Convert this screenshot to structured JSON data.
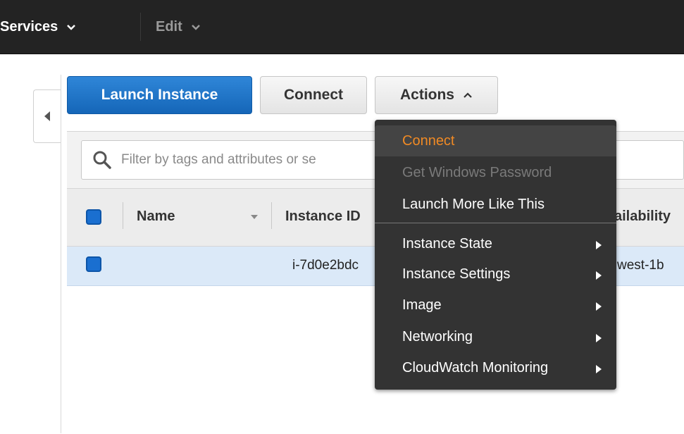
{
  "topbar": {
    "services_label": "Services",
    "edit_label": "Edit"
  },
  "toolbar": {
    "launch_label": "Launch Instance",
    "connect_label": "Connect",
    "actions_label": "Actions"
  },
  "search": {
    "placeholder": "Filter by tags and attributes or se"
  },
  "table": {
    "columns": [
      "Name",
      "Instance ID",
      "ailability"
    ],
    "rows": [
      {
        "name": "",
        "instance_id": "i-7d0e2bdc",
        "availability": "west-1b"
      }
    ]
  },
  "actions_menu": {
    "items": [
      {
        "label": "Connect",
        "state": "active"
      },
      {
        "label": "Get Windows Password",
        "state": "disabled"
      },
      {
        "label": "Launch More Like This",
        "state": "normal"
      },
      {
        "label": "Instance State",
        "state": "submenu"
      },
      {
        "label": "Instance Settings",
        "state": "submenu"
      },
      {
        "label": "Image",
        "state": "submenu"
      },
      {
        "label": "Networking",
        "state": "submenu"
      },
      {
        "label": "CloudWatch Monitoring",
        "state": "submenu"
      }
    ]
  },
  "colors": {
    "primary_button": "#1a72c9",
    "menu_bg": "#333333",
    "menu_active_text": "#f08a24",
    "selected_row": "#dbe9f8"
  },
  "icons": {
    "search": "search-icon",
    "collapse": "chevron-left-icon",
    "submenu": "chevron-right-icon"
  }
}
